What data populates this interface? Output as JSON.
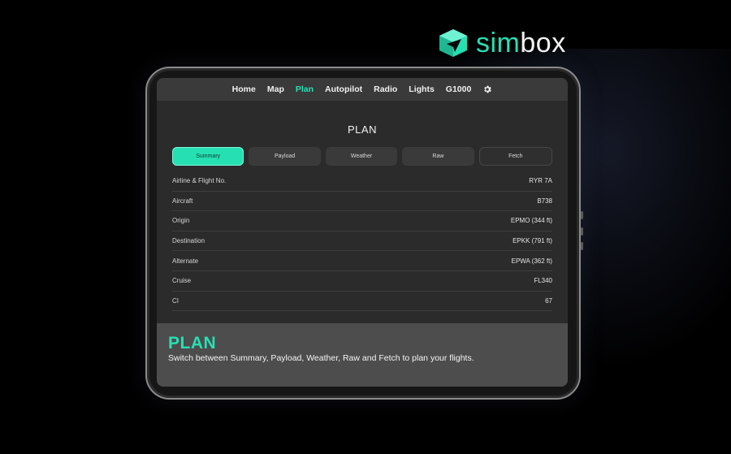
{
  "brand": {
    "name_part1": "sim",
    "name_part2": "box",
    "icon": "box-paper-plane-icon",
    "color": "#26e0b3"
  },
  "nav": {
    "items": [
      {
        "label": "Home",
        "active": false
      },
      {
        "label": "Map",
        "active": false
      },
      {
        "label": "Plan",
        "active": true
      },
      {
        "label": "Autopilot",
        "active": false
      },
      {
        "label": "Radio",
        "active": false
      },
      {
        "label": "Lights",
        "active": false
      },
      {
        "label": "G1000",
        "active": false
      }
    ],
    "settings_icon": "gear-icon"
  },
  "page": {
    "title": "PLAN"
  },
  "tabs": [
    {
      "label": "Summary",
      "active": true
    },
    {
      "label": "Payload",
      "active": false
    },
    {
      "label": "Weather",
      "active": false
    },
    {
      "label": "Raw",
      "active": false
    },
    {
      "label": "Fetch",
      "active": false
    }
  ],
  "summary_rows": [
    {
      "label": "Airline & Flight No.",
      "value": "RYR 7A"
    },
    {
      "label": "Aircraft",
      "value": "B738"
    },
    {
      "label": "Origin",
      "value": "EPMO (344 ft)"
    },
    {
      "label": "Destination",
      "value": "EPKK (791 ft)"
    },
    {
      "label": "Alternate",
      "value": "EPWA (362 ft)"
    },
    {
      "label": "Cruise",
      "value": "FL340"
    },
    {
      "label": "CI",
      "value": "67"
    }
  ],
  "caption": {
    "title": "PLAN",
    "description": "Switch between Summary, Payload, Weather, Raw and Fetch to plan your flights."
  },
  "colors": {
    "accent": "#26e0b3",
    "background": "#000000",
    "screen": "#2b2b2b"
  }
}
